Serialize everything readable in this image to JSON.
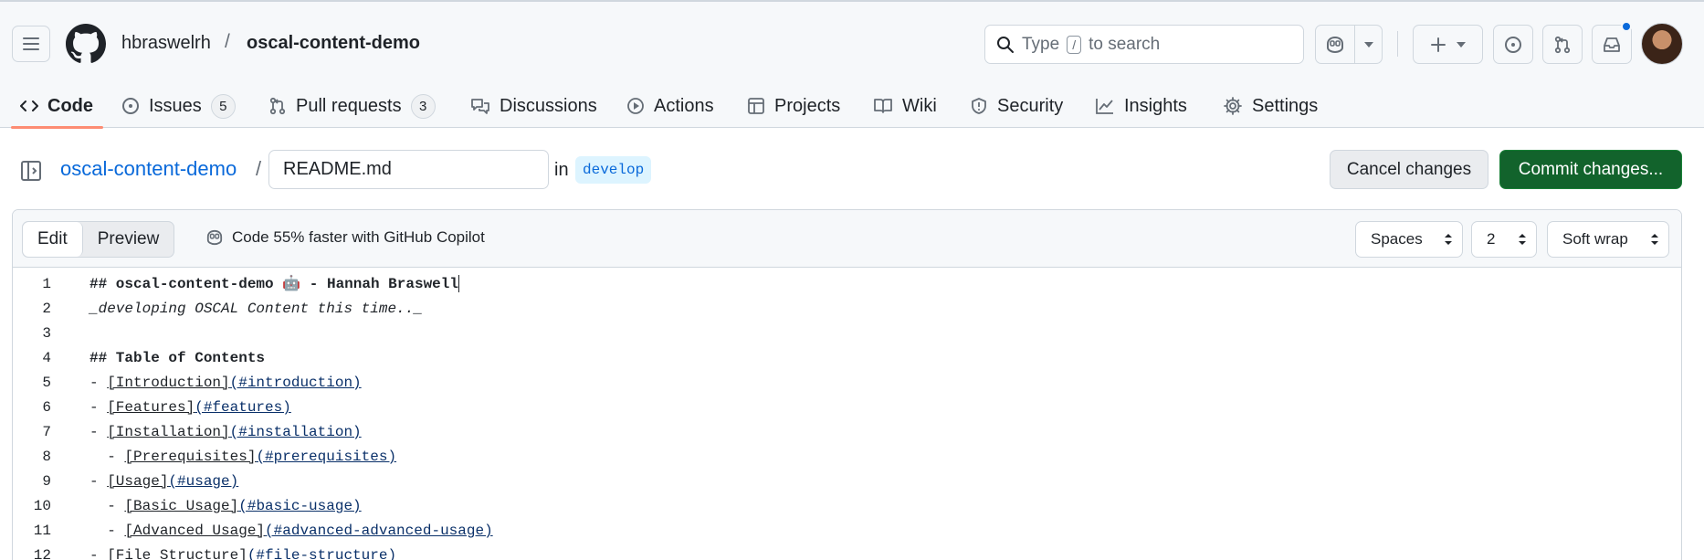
{
  "header": {
    "owner": "hbraswelrh",
    "separator": "/",
    "repo": "oscal-content-demo",
    "search": {
      "prefix": "Type",
      "key": "/",
      "suffix": "to search"
    }
  },
  "nav": {
    "code": "Code",
    "issues": "Issues",
    "issues_count": "5",
    "pulls": "Pull requests",
    "pulls_count": "3",
    "discussions": "Discussions",
    "actions": "Actions",
    "projects": "Projects",
    "wiki": "Wiki",
    "security": "Security",
    "insights": "Insights",
    "settings": "Settings"
  },
  "editor_header": {
    "repo_link": "oscal-content-demo",
    "slash": "/",
    "filename": "README.md",
    "in": "in",
    "branch": "develop",
    "cancel": "Cancel changes",
    "commit": "Commit changes..."
  },
  "toolbar": {
    "edit": "Edit",
    "preview": "Preview",
    "copilot_hint": "Code 55% faster with GitHub Copilot",
    "indent_mode": "Spaces",
    "indent_size": "2",
    "wrap_mode": "Soft wrap"
  },
  "code": {
    "l1": "## oscal-content-demo 🤖 - Hannah Braswell",
    "l2": "_developing OSCAL Content this time.._",
    "l4": "## Table of Contents",
    "l5_text": "[Introduction]",
    "l5_href": "(#introduction)",
    "l6_text": "[Features]",
    "l6_href": "(#features)",
    "l7_text": "[Installation]",
    "l7_href": "(#installation)",
    "l8_text": "[Prerequisites]",
    "l8_href": "(#prerequisites)",
    "l9_text": "[Usage]",
    "l9_href": "(#usage)",
    "l10_text": "[Basic Usage]",
    "l10_href": "(#basic-usage)",
    "l11_text": "[Advanced Usage]",
    "l11_href": "(#advanced-advanced-usage)",
    "l12_text": "[File Structure]",
    "l12_href": "(#file-structure)"
  },
  "colors": {
    "accent": "#0969da",
    "commit_button": "#12632c",
    "nav_underline": "#fd8c73",
    "branch_bg": "#ddf4ff"
  }
}
